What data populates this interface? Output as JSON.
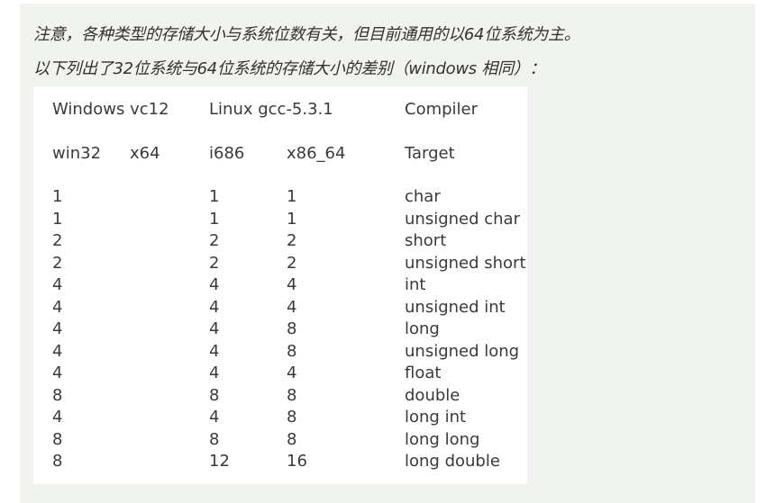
{
  "notes": {
    "line1": "注意，各种类型的存储大小与系统位数有关，但目前通用的以64位系统为主。",
    "line2": "以下列出了32位系统与64位系统的存储大小的差别（windows 相同）："
  },
  "table": {
    "header_groups": [
      "Windows vc12",
      "Linux gcc-5.3.1",
      "Compiler"
    ],
    "subheaders": [
      "win32",
      "x64",
      "i686",
      "x86_64",
      "Target"
    ],
    "rows": [
      [
        "1",
        "",
        "1",
        "1",
        "char"
      ],
      [
        "1",
        "",
        "1",
        "1",
        "unsigned char"
      ],
      [
        "2",
        "",
        "2",
        "2",
        "short"
      ],
      [
        "2",
        "",
        "2",
        "2",
        "unsigned short"
      ],
      [
        "4",
        "",
        "4",
        "4",
        "int"
      ],
      [
        "4",
        "",
        "4",
        "4",
        "unsigned int"
      ],
      [
        "4",
        "",
        "4",
        "8",
        "long"
      ],
      [
        "4",
        "",
        "4",
        "8",
        "unsigned long"
      ],
      [
        "4",
        "",
        "4",
        "4",
        "float"
      ],
      [
        "8",
        "",
        "8",
        "8",
        "double"
      ],
      [
        "4",
        "",
        "4",
        "8",
        "long int"
      ],
      [
        "8",
        "",
        "8",
        "8",
        "long long"
      ],
      [
        "8",
        "",
        "12",
        "16",
        "long double"
      ]
    ]
  }
}
